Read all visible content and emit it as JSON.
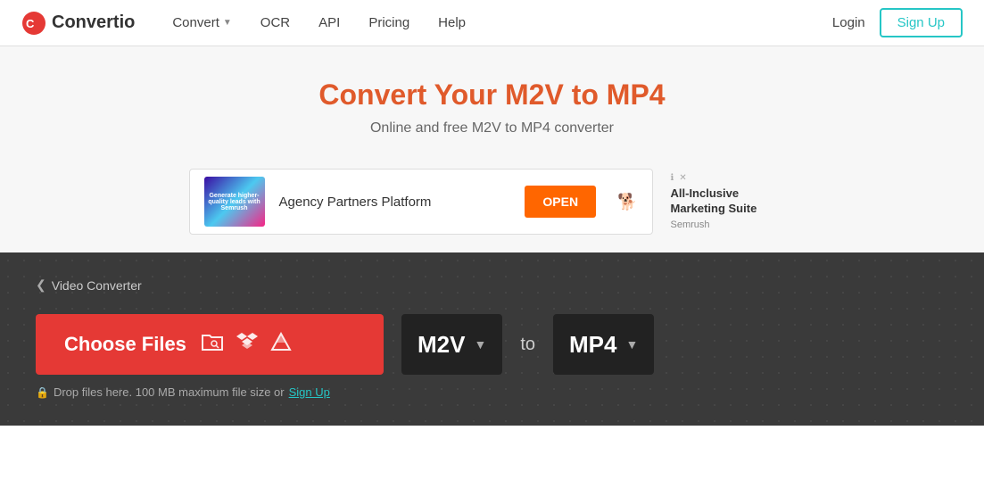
{
  "header": {
    "logo_text": "Convertio",
    "nav": [
      {
        "label": "Convert",
        "has_arrow": true
      },
      {
        "label": "OCR",
        "has_arrow": false
      },
      {
        "label": "API",
        "has_arrow": false
      },
      {
        "label": "Pricing",
        "has_arrow": false
      },
      {
        "label": "Help",
        "has_arrow": false
      }
    ],
    "login_label": "Login",
    "signup_label": "Sign Up"
  },
  "hero": {
    "title": "Convert Your M2V to MP4",
    "subtitle": "Online and free M2V to MP4 converter"
  },
  "ad": {
    "image_text": "Generate higher-quality leads with Semrush",
    "text": "Agency Partners Platform",
    "open_btn": "OPEN",
    "side_title": "All-Inclusive Marketing Suite",
    "side_brand": "Semrush"
  },
  "converter": {
    "breadcrumb": "Video Converter",
    "choose_files_label": "Choose Files",
    "from_format": "M2V",
    "to_label": "to",
    "to_format": "MP4",
    "drop_hint": "Drop files here. 100 MB maximum file size or",
    "signup_link": "Sign Up"
  }
}
